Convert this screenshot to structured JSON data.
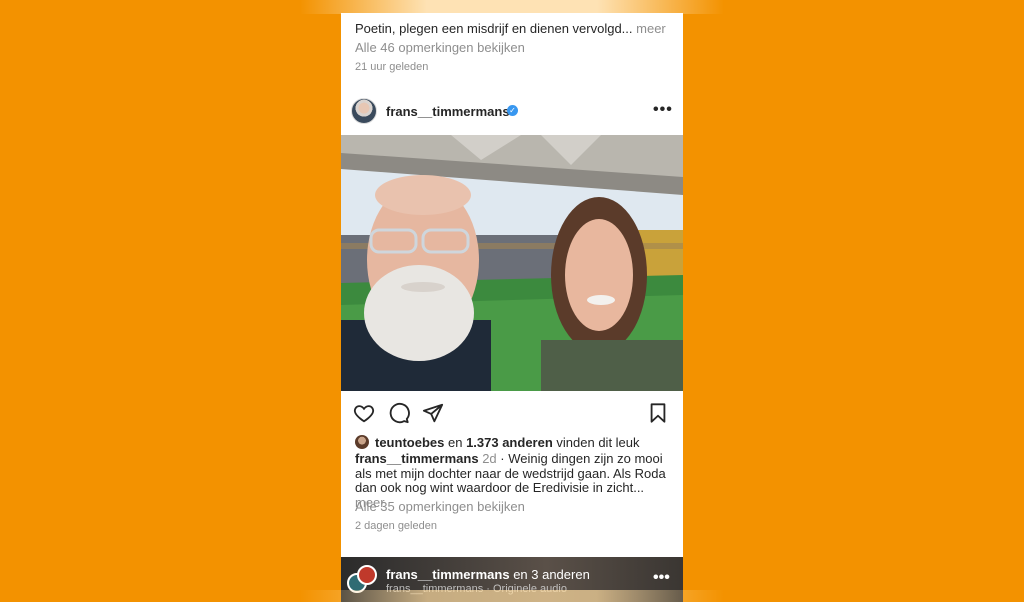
{
  "colors": {
    "background": "#f39200",
    "card": "#ffffff",
    "muted_text": "#8e8e8e",
    "verified_badge": "#3897f0"
  },
  "previous_post": {
    "caption_text": "Poetin, plegen een misdrijf en dienen vervolgd...",
    "more_label": "meer",
    "view_comments": "Alle 46 opmerkingen bekijken",
    "timestamp": "21 uur geleden"
  },
  "post": {
    "username": "frans__timmermans",
    "verified_icon": "verified-badge-icon",
    "options_icon": "more-options-icon",
    "image_alt": "selfie-stadium-photo",
    "actions": {
      "like_icon": "heart-icon",
      "comment_icon": "comment-icon",
      "share_icon": "send-icon",
      "save_icon": "bookmark-icon"
    },
    "likes": {
      "first_user": "teuntoebes",
      "connector": "en",
      "others_count": "1.373 anderen",
      "suffix": "vinden dit leuk"
    },
    "caption": {
      "username": "frans__timmermans",
      "time": "2d",
      "text": "· Weinig dingen zijn zo mooi als met mijn dochter naar de wedstrijd gaan. Als Roda dan ook nog wint waardoor de Eredivisie in zicht...",
      "more_label": "meer"
    },
    "view_comments": "Alle 35 opmerkingen bekijken",
    "timestamp": "2 dagen geleden"
  },
  "next_post": {
    "username": "frans__timmermans",
    "others": "en 3 anderen",
    "subtitle": "frans__timmermans · Originele audio"
  }
}
